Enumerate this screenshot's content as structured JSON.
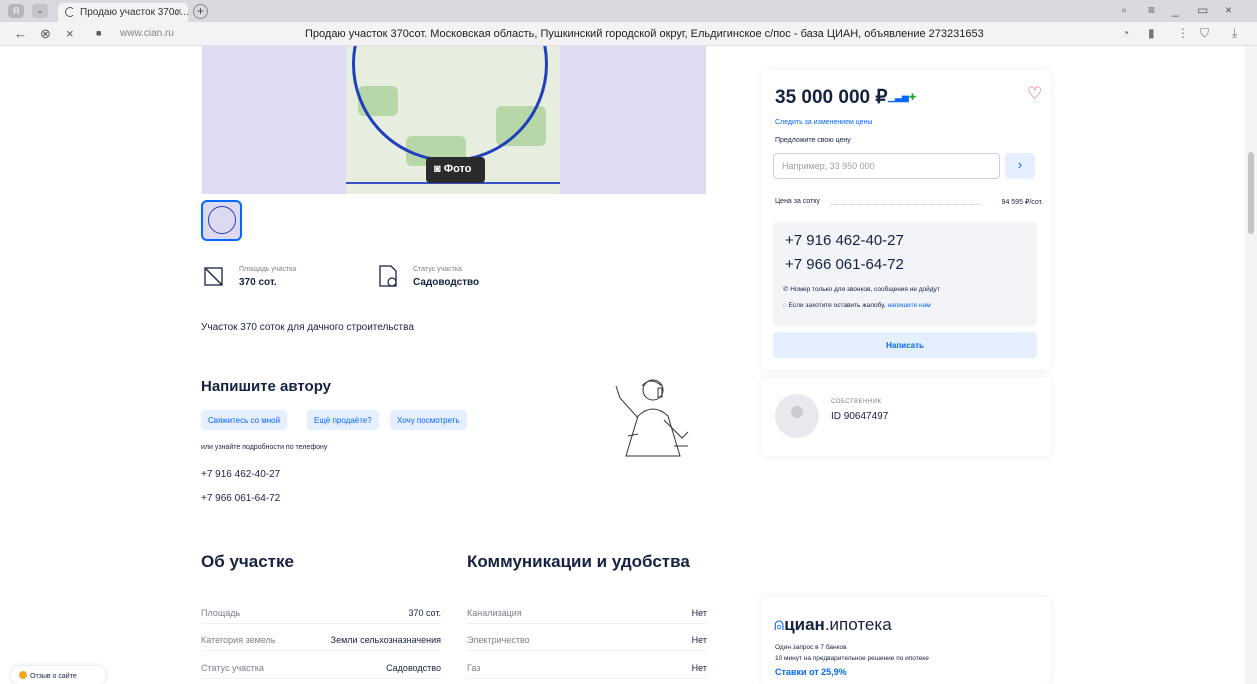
{
  "browser": {
    "tab_title": "Продаю участок 370с…",
    "tab_close": "×",
    "new_tab": "+",
    "yandex_btn": "Я",
    "domain": "www.cian.ru",
    "page_title": "Продаю участок 370сот. Московская область, Пушкинский городской округ, Ельдигинское с/пос - база ЦИАН, объявление 273231653",
    "nav": {
      "back": "←",
      "reload": "⊗",
      "close": "×",
      "secure": "🔒"
    }
  },
  "gallery": {
    "photo_button": "Фото"
  },
  "features": [
    {
      "label": "Площадь участка",
      "value": "370 сот."
    },
    {
      "label": "Статус участка",
      "value": "Садоводство"
    }
  ],
  "description": "Участок 370 соток для дачного строительства",
  "author": {
    "heading": "Напишите автору",
    "chips": [
      "Свяжитесь со мной",
      "Ещё продаёте?",
      "Хочу посмотреть"
    ],
    "or_phone": "или узнайте подробности по телефону",
    "phones": [
      "+7 916 462-40-27",
      "+7 966 061-64-72"
    ]
  },
  "about": {
    "heading": "Об участке",
    "rows": [
      {
        "k": "Площадь",
        "v": "370 сот."
      },
      {
        "k": "Категория земель",
        "v": "Земли сельхозназначения"
      },
      {
        "k": "Статус участка",
        "v": "Садоводство"
      }
    ]
  },
  "utilities": {
    "heading": "Коммуникации и удобства",
    "rows": [
      {
        "k": "Канализация",
        "v": "Нет"
      },
      {
        "k": "Электричество",
        "v": "Нет"
      },
      {
        "k": "Газ",
        "v": "Нет"
      }
    ]
  },
  "price_card": {
    "price": "35 000 000 ₽",
    "follow": "Следить за изменением цены",
    "offer_label": "Предложите свою цену",
    "offer_placeholder": "Например, 33 950 000",
    "offer_go": "›",
    "per_unit_label": "Цена за сотку",
    "per_unit_value": "94 595 ₽/сот.",
    "phones": [
      "+7 916 462-40-27",
      "+7 966 061-64-72"
    ],
    "note_calls": "Номер только для звонков, сообщения не дойдут",
    "note_complaint": "Если захотите оставить жалобу,",
    "note_complaint_link": "напишите нам",
    "write_button": "Написать"
  },
  "owner": {
    "role": "СОБСТВЕННИК",
    "id": "ID 90647497"
  },
  "mortgage": {
    "logo_a": "циан",
    "logo_b": ".ипотека",
    "line1": "Один запрос в 7 банков",
    "line2": "10 минут на предварительное решение по ипотеке",
    "rate": "Ставки от 25,9%"
  },
  "feedback": "Отзыв о сайте",
  "colors": {
    "accent": "#0468ff",
    "text": "#152242",
    "fav": "#e84260"
  }
}
